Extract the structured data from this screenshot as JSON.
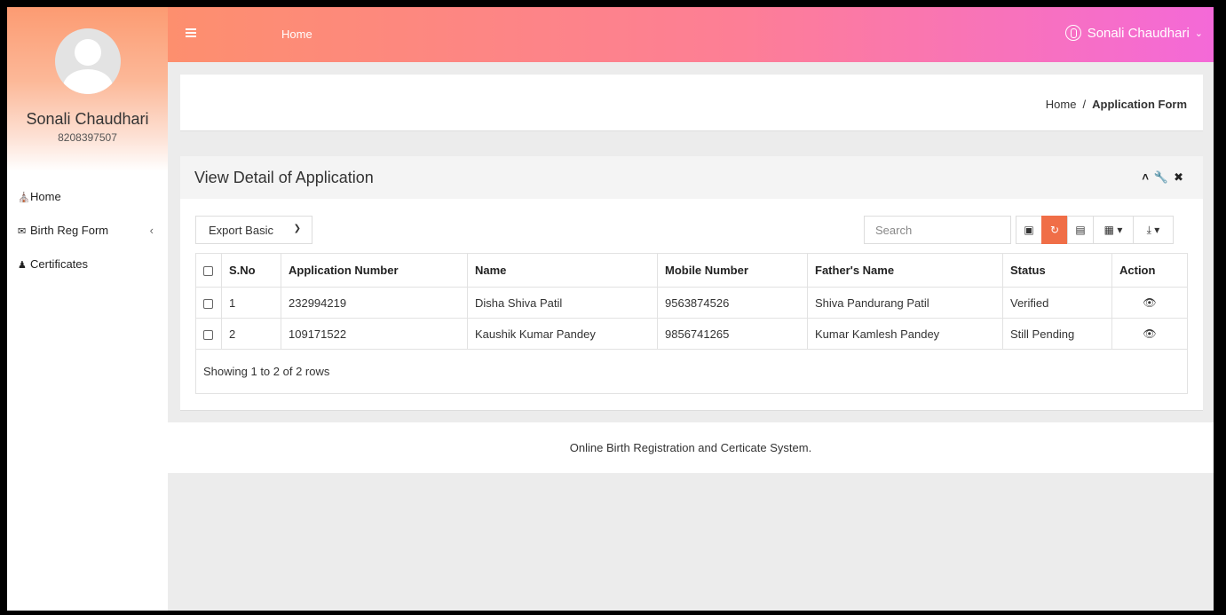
{
  "sidebar": {
    "profile_name": "Sonali Chaudhari",
    "profile_phone": "8208397507",
    "items": [
      {
        "label": "Home",
        "icon": "home-icon"
      },
      {
        "label": "Birth Reg Form",
        "icon": "envelope-icon"
      },
      {
        "label": "Certificates",
        "icon": "user-icon"
      }
    ]
  },
  "topbar": {
    "title": "Home",
    "user_name": "Sonali Chaudhari"
  },
  "breadcrumb": {
    "home": "Home",
    "separator": "/",
    "current": "Application Form"
  },
  "panel": {
    "title": "View Detail of Application",
    "export_label": "Export Basic",
    "search_placeholder": "Search"
  },
  "table": {
    "columns": [
      "S.No",
      "Application Number",
      "Name",
      "Mobile Number",
      "Father's Name",
      "Status",
      "Action"
    ],
    "rows": [
      {
        "sno": "1",
        "app_no": "232994219",
        "name": "Disha Shiva Patil",
        "mobile": "9563874526",
        "father": "Shiva Pandurang Patil",
        "status": "Verified"
      },
      {
        "sno": "2",
        "app_no": "109171522",
        "name": "Kaushik Kumar Pandey",
        "mobile": "9856741265",
        "father": "Kumar Kamlesh Pandey",
        "status": "Still Pending"
      }
    ],
    "footer": "Showing 1 to 2 of 2 rows"
  },
  "footer": {
    "text": "Online Birth Registration and Certicate System."
  },
  "colors": {
    "accent": "#f06e47",
    "topbar_start": "#fd8f6e",
    "topbar_end": "#f469d8"
  }
}
